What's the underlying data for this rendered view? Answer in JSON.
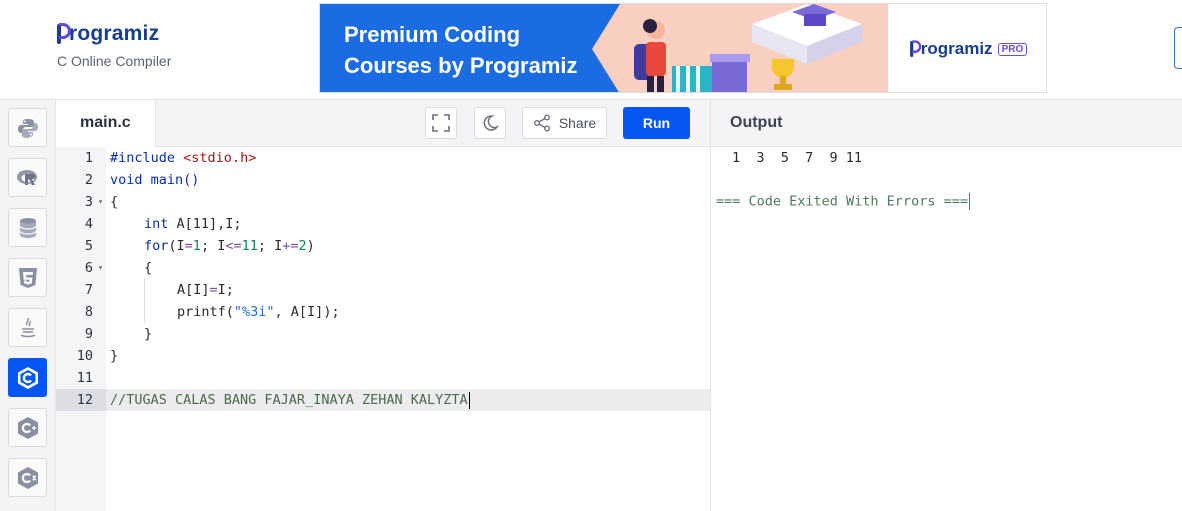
{
  "brand": {
    "name": "rogramiz",
    "subtitle": "C Online Compiler"
  },
  "ad": {
    "headline_line1": "Premium Coding",
    "headline_line2": "Courses by Programiz",
    "logo_text": "rogramiz",
    "badge": "PRO"
  },
  "sidebar": {
    "items": [
      {
        "name": "python",
        "icon": "python-icon"
      },
      {
        "name": "r",
        "icon": "r-icon"
      },
      {
        "name": "sql",
        "icon": "database-icon"
      },
      {
        "name": "html",
        "icon": "html5-icon"
      },
      {
        "name": "java",
        "icon": "java-icon"
      },
      {
        "name": "c",
        "icon": "c-icon",
        "active": true
      },
      {
        "name": "cpp",
        "icon": "cpp-icon"
      },
      {
        "name": "csharp",
        "icon": "csharp-icon"
      }
    ]
  },
  "editor": {
    "tab": "main.c",
    "share_label": "Share",
    "run_label": "Run",
    "line_numbers": [
      "1",
      "2",
      "3",
      "4",
      "5",
      "6",
      "7",
      "8",
      "9",
      "10",
      "11",
      "12"
    ],
    "lines": {
      "l1a": "#include",
      "l1b": "<stdio.h>",
      "l2": "void main()",
      "l3": "{",
      "l4a": "int",
      "l4b": " A[11],I;",
      "l5a": "for",
      "l5b": "(I",
      "l5c": "=",
      "l5d": "1",
      "l5e": "; I",
      "l5f": "<=",
      "l5g": "11",
      "l5h": "; I",
      "l5i": "+=",
      "l5j": "2",
      "l5k": ")",
      "l6": "{",
      "l7a": "A[I]",
      "l7b": "=",
      "l7c": "I;",
      "l8a": "printf(",
      "l8b": "\"%3i\"",
      "l8c": ", A[I]);",
      "l9": "}",
      "l10": "}",
      "l11": "",
      "l12": "//TUGAS CALAS BANG FAJAR_INAYA ZEHAN KALYZTA"
    }
  },
  "output": {
    "title": "Output",
    "result": "1  3  5  7  9 11",
    "status": "=== Code Exited With Errors ==="
  },
  "colors": {
    "accent": "#0556f3",
    "brand": "#1a3d8f"
  }
}
